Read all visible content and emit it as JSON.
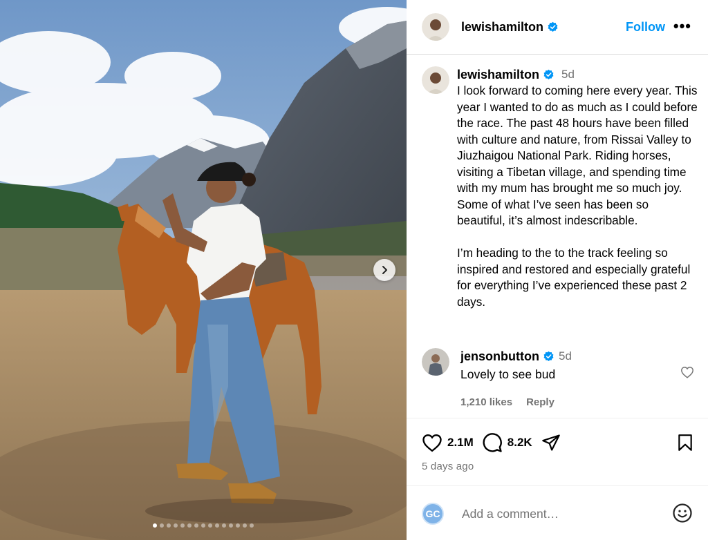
{
  "post": {
    "username": "lewishamilton",
    "follow_label": "Follow",
    "more_label": "•••",
    "caption_time": "5d",
    "caption": "I look forward to coming here every year. This year I wanted to do as much as I could before the race. The past 48 hours have been filled with culture and nature, from Rissai Valley to Jiuzhaigou National Park. Riding horses, visiting a Tibetan village, and spending time with my mum has brought me so much joy. Some of what I’ve seen has been so beautiful, it’s almost indescribable.\n\nI’m heading to the to the track feeling so inspired and restored and especially grateful for everything I’ve experienced these past 2 days."
  },
  "comment": {
    "username": "jensonbutton",
    "time": "5d",
    "text": "Lovely to see bud",
    "likes": "1,210 likes",
    "reply_label": "Reply"
  },
  "actions": {
    "likes_count": "2.1M",
    "comments_count": "8.2K",
    "posted_ago": "5 days ago"
  },
  "add_comment": {
    "avatar_initials": "GC",
    "placeholder": "Add a comment…"
  },
  "carousel": {
    "slide_count": 15,
    "active_index": 0
  },
  "colors": {
    "accent": "#0095f6",
    "verified": "#0095f6",
    "muted": "#737373",
    "divider": "#dbdbdb"
  },
  "icons": [
    "verified-icon",
    "more-icon",
    "heart-icon",
    "comment-icon",
    "share-icon",
    "save-icon",
    "emoji-icon",
    "chevron-right-icon"
  ]
}
